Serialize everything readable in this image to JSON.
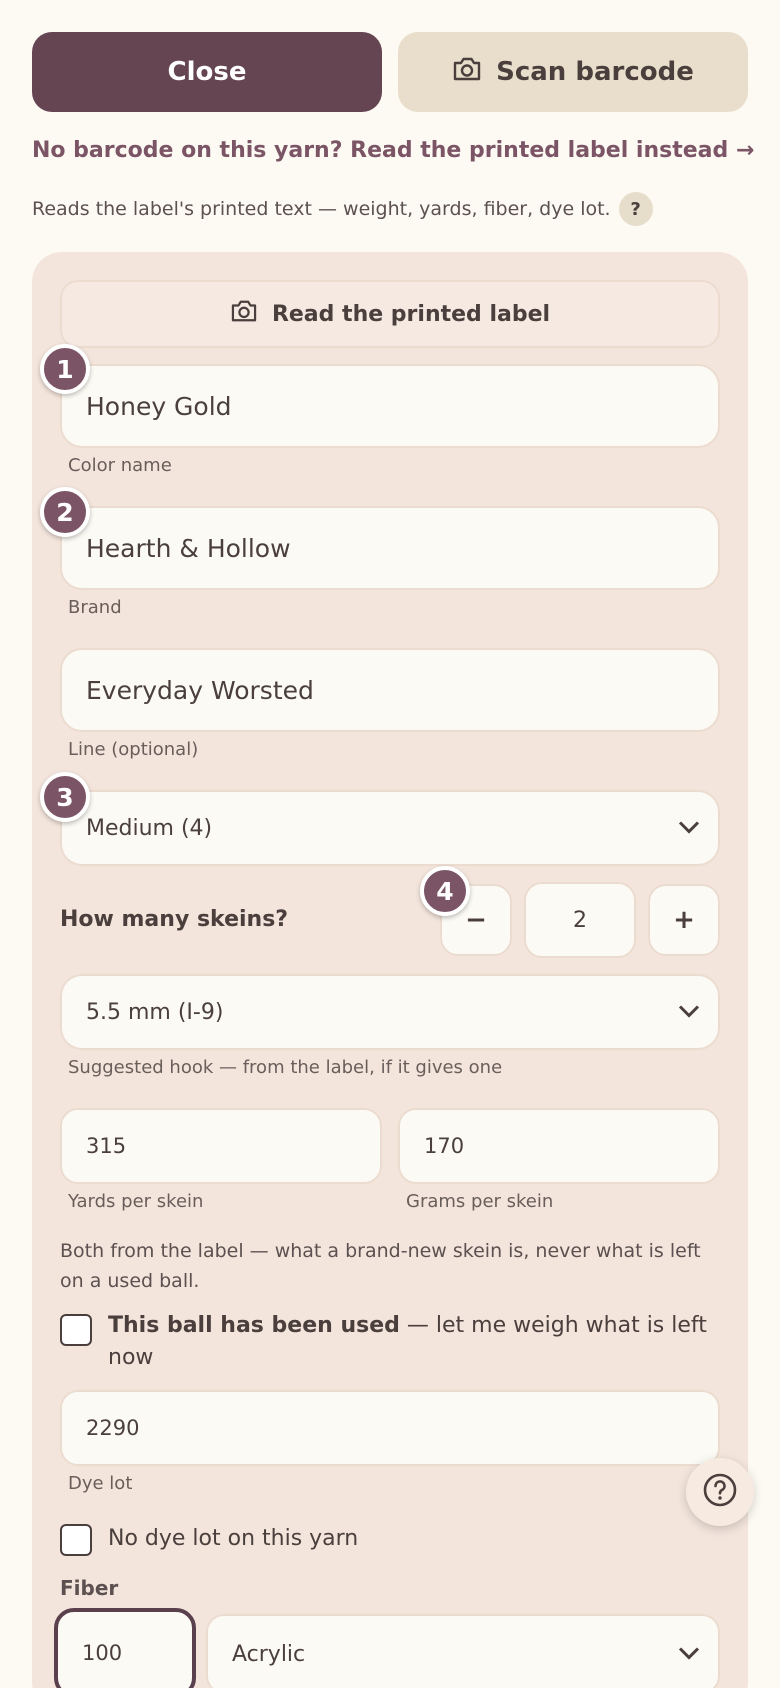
{
  "header": {
    "close_label": "Close",
    "scan_label": "Scan barcode",
    "alt_link": "No barcode on this yarn? Read the printed label instead →",
    "alt_helper": "Reads the label's printed text — weight, yards, fiber, dye lot.",
    "help_glyph": "?"
  },
  "form": {
    "read_label_button": "Read the printed label",
    "color_name": {
      "value": "Honey Gold",
      "caption": "Color name",
      "badge": "1"
    },
    "brand": {
      "value": "Hearth & Hollow",
      "caption": "Brand",
      "badge": "2"
    },
    "line": {
      "value": "Everyday Worsted",
      "caption": "Line (optional)"
    },
    "weight": {
      "value": "Medium (4)",
      "badge": "3"
    },
    "skeins": {
      "label": "How many skeins?",
      "minus": "−",
      "count": "2",
      "plus": "+",
      "badge": "4"
    },
    "hook": {
      "value": "5.5 mm (I-9)",
      "caption": "Suggested hook — from the label, if it gives one"
    },
    "yards": {
      "value": "315",
      "caption": "Yards per skein"
    },
    "grams": {
      "value": "170",
      "caption": "Grams per skein"
    },
    "skein_note": "Both from the label — what a brand-new skein is, never what is left on a used ball.",
    "used_check": {
      "bold": "This ball has been used",
      "rest": " — let me weigh what is left now"
    },
    "dye_lot": {
      "value": "2290",
      "caption": "Dye lot"
    },
    "no_dye_lot": "No dye lot on this yarn",
    "fiber": {
      "label": "Fiber",
      "percent": "100",
      "type": "Acrylic"
    }
  },
  "colors": {
    "primary": "#654552",
    "accent": "#7b5566",
    "secondary": "#e8decb",
    "card": "#f3e5dc",
    "background": "#fdfaf3"
  },
  "icons": {
    "scan": "camera-icon",
    "read": "camera-icon",
    "select": "chevron-down-icon",
    "fab": "help-circle-icon"
  }
}
